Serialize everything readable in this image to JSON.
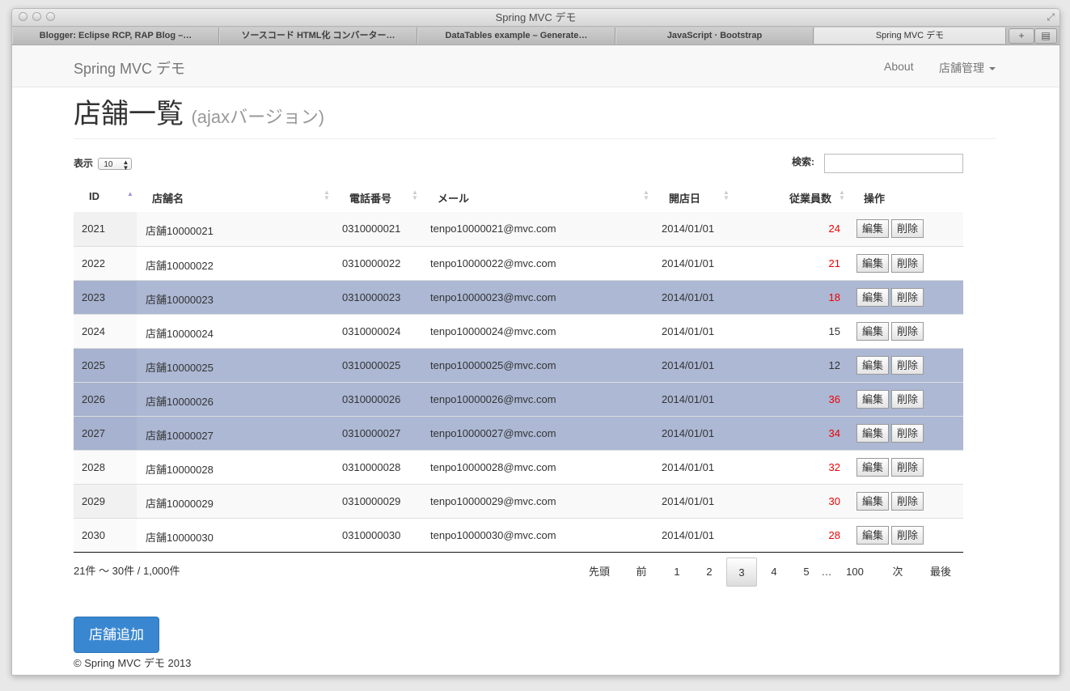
{
  "window": {
    "title": "Spring MVC デモ"
  },
  "tabs": [
    {
      "label": "Blogger: Eclipse RCP, RAP Blog –…",
      "active": false
    },
    {
      "label": "ソースコード HTML化 コンバーター…",
      "active": false
    },
    {
      "label": "DataTables example – Generate…",
      "active": false
    },
    {
      "label": "JavaScript · Bootstrap",
      "active": false
    },
    {
      "label": "Spring MVC デモ",
      "active": true
    }
  ],
  "tab_tools": {
    "new_tab": "+",
    "tab_overview": "▤"
  },
  "navbar": {
    "brand": "Spring MVC デモ",
    "about": "About",
    "store_menu": "店舗管理"
  },
  "header": {
    "title": "店舗一覧",
    "subtitle": "(ajaxバージョン)"
  },
  "length": {
    "label": "表示",
    "value": "10"
  },
  "search": {
    "label": "検索:",
    "value": ""
  },
  "columns": {
    "id": "ID",
    "name": "店舗名",
    "phone": "電話番号",
    "mail": "メール",
    "opened": "開店日",
    "staff": "従業員数",
    "actions": "操作"
  },
  "rows": [
    {
      "id": "2021",
      "name": "店舗10000021",
      "phone": "0310000021",
      "mail": "tenpo10000021@mvc.com",
      "opened": "2014/01/01",
      "staff": "24",
      "staff_red": true,
      "selected": false
    },
    {
      "id": "2022",
      "name": "店舗10000022",
      "phone": "0310000022",
      "mail": "tenpo10000022@mvc.com",
      "opened": "2014/01/01",
      "staff": "21",
      "staff_red": true,
      "selected": false
    },
    {
      "id": "2023",
      "name": "店舗10000023",
      "phone": "0310000023",
      "mail": "tenpo10000023@mvc.com",
      "opened": "2014/01/01",
      "staff": "18",
      "staff_red": true,
      "selected": true
    },
    {
      "id": "2024",
      "name": "店舗10000024",
      "phone": "0310000024",
      "mail": "tenpo10000024@mvc.com",
      "opened": "2014/01/01",
      "staff": "15",
      "staff_red": false,
      "selected": false
    },
    {
      "id": "2025",
      "name": "店舗10000025",
      "phone": "0310000025",
      "mail": "tenpo10000025@mvc.com",
      "opened": "2014/01/01",
      "staff": "12",
      "staff_red": false,
      "selected": true
    },
    {
      "id": "2026",
      "name": "店舗10000026",
      "phone": "0310000026",
      "mail": "tenpo10000026@mvc.com",
      "opened": "2014/01/01",
      "staff": "36",
      "staff_red": true,
      "selected": true
    },
    {
      "id": "2027",
      "name": "店舗10000027",
      "phone": "0310000027",
      "mail": "tenpo10000027@mvc.com",
      "opened": "2014/01/01",
      "staff": "34",
      "staff_red": true,
      "selected": true
    },
    {
      "id": "2028",
      "name": "店舗10000028",
      "phone": "0310000028",
      "mail": "tenpo10000028@mvc.com",
      "opened": "2014/01/01",
      "staff": "32",
      "staff_red": true,
      "selected": false
    },
    {
      "id": "2029",
      "name": "店舗10000029",
      "phone": "0310000029",
      "mail": "tenpo10000029@mvc.com",
      "opened": "2014/01/01",
      "staff": "30",
      "staff_red": true,
      "selected": false
    },
    {
      "id": "2030",
      "name": "店舗10000030",
      "phone": "0310000030",
      "mail": "tenpo10000030@mvc.com",
      "opened": "2014/01/01",
      "staff": "28",
      "staff_red": true,
      "selected": false
    }
  ],
  "row_actions": {
    "edit": "編集",
    "delete": "削除"
  },
  "info": "21件 〜 30件 / 1,000件",
  "pagination": [
    {
      "label": "先頭",
      "current": false
    },
    {
      "label": "前",
      "current": false
    },
    {
      "label": "1",
      "current": false
    },
    {
      "label": "2",
      "current": false
    },
    {
      "label": "3",
      "current": true
    },
    {
      "label": "4",
      "current": false
    },
    {
      "label": "5",
      "current": false
    },
    {
      "label": "…",
      "current": false
    },
    {
      "label": "100",
      "current": false
    },
    {
      "label": "次",
      "current": false
    },
    {
      "label": "最後",
      "current": false
    }
  ],
  "add_button": "店舗追加",
  "footer": "© Spring MVC デモ 2013",
  "colors": {
    "selected_row": "#acb8d4",
    "primary": "#3a87d1",
    "alert_text": "#e00000"
  }
}
